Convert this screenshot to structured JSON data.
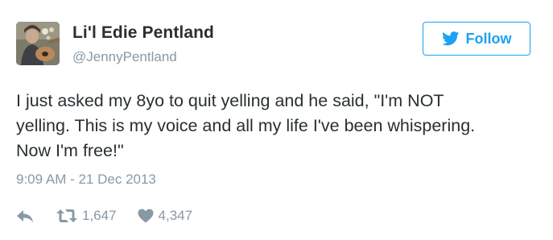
{
  "user": {
    "display_name": "Li'l Edie Pentland",
    "handle": "@JennyPentland",
    "avatar_icon": "profile-photo"
  },
  "follow_button": {
    "label": "Follow",
    "icon": "twitter-bird-icon",
    "color": "#1da1f2"
  },
  "tweet": {
    "text_lines": [
      "I just asked my 8yo to quit yelling and he said, \"I'm NOT",
      "yelling. This is my voice and all my life I've been whispering.",
      "Now I'm free!\""
    ],
    "timestamp": "9:09 AM - 21 Dec 2013"
  },
  "actions": {
    "reply_icon": "reply-icon",
    "retweet_icon": "retweet-icon",
    "retweet_count": "1,647",
    "like_icon": "heart-icon",
    "like_count": "4,347"
  },
  "colors": {
    "text": "#292f33",
    "muted": "#8899a6",
    "accent": "#1da1f2"
  }
}
